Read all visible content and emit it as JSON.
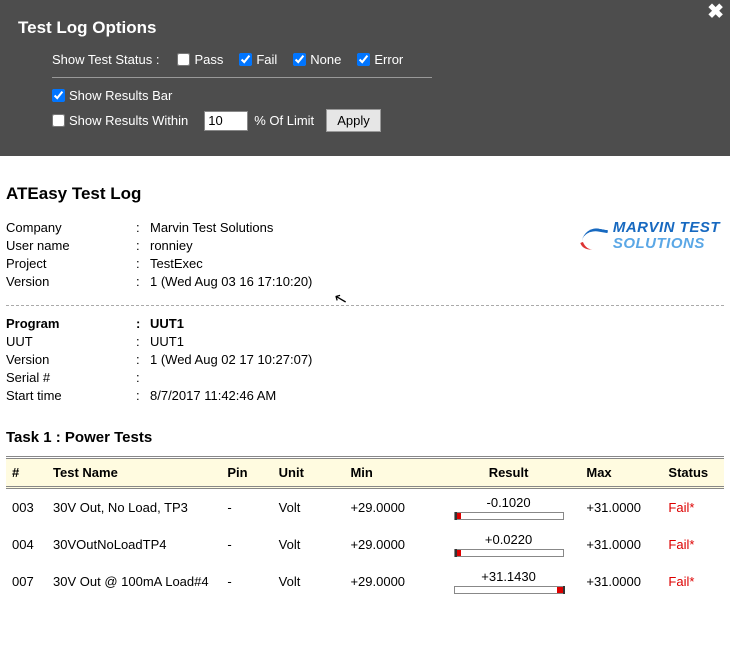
{
  "options": {
    "title": "Test Log Options",
    "status_label": "Show Test Status :",
    "pass_label": "Pass",
    "fail_label": "Fail",
    "none_label": "None",
    "error_label": "Error",
    "results_bar_label": "Show Results Bar",
    "results_within_label": "Show Results Within",
    "within_value": "10",
    "within_suffix": "% Of Limit",
    "apply_label": "Apply",
    "checked": {
      "pass": false,
      "fail": true,
      "none": true,
      "error": true,
      "results_bar": true,
      "results_within": false
    }
  },
  "page_title": "ATEasy Test Log",
  "meta1": {
    "company_label": "Company",
    "company": "Marvin Test Solutions",
    "user_label": "User name",
    "user": "ronniey",
    "project_label": "Project",
    "project": "TestExec",
    "version_label": "Version",
    "version": "1 (Wed Aug 03 16 17:10:20)"
  },
  "meta2": {
    "program_label": "Program",
    "program": "UUT1",
    "uut_label": "UUT",
    "uut": "UUT1",
    "version_label": "Version",
    "version": "1 (Wed Aug 02 17 10:27:07)",
    "serial_label": "Serial #",
    "serial": "",
    "start_label": "Start time",
    "start": "8/7/2017 11:42:46 AM"
  },
  "logo": {
    "line1": "MARVIN TEST",
    "line2": "SOLUTIONS"
  },
  "task_title": "Task 1 : Power Tests",
  "headers": {
    "num": "#",
    "name": "Test Name",
    "pin": "Pin",
    "unit": "Unit",
    "min": "Min",
    "result": "Result",
    "max": "Max",
    "status": "Status"
  },
  "rows": [
    {
      "num": "003",
      "name": "30V Out, No Load, TP3",
      "pin": "-",
      "unit": "Volt",
      "min": "+29.0000",
      "result": "-0.1020",
      "max": "+31.0000",
      "status": "Fail*",
      "bar": {
        "under": true,
        "over": false,
        "marker_pct": 0
      }
    },
    {
      "num": "004",
      "name": "30VOutNoLoadTP4",
      "pin": "-",
      "unit": "Volt",
      "min": "+29.0000",
      "result": "+0.0220",
      "max": "+31.0000",
      "status": "Fail*",
      "bar": {
        "under": true,
        "over": false,
        "marker_pct": 0
      }
    },
    {
      "num": "007",
      "name": "30V Out @ 100mA Load#4",
      "pin": "-",
      "unit": "Volt",
      "min": "+29.0000",
      "result": "+31.1430",
      "max": "+31.0000",
      "status": "Fail*",
      "bar": {
        "under": false,
        "over": true,
        "marker_pct": 100
      }
    }
  ]
}
